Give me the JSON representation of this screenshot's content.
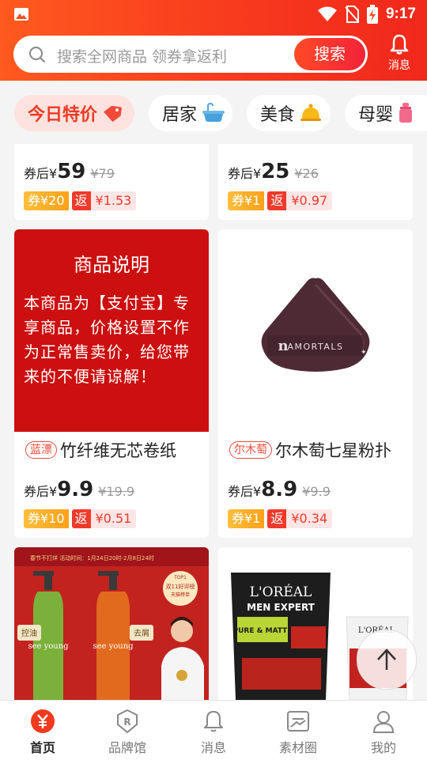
{
  "status": {
    "time": "9:17"
  },
  "header": {
    "search_placeholder": "搜索全网商品 领券拿返利",
    "search_button": "搜索",
    "message_label": "消息"
  },
  "categories": [
    {
      "label": "今日特价",
      "icon": "price-tag-icon",
      "active": true
    },
    {
      "label": "居家",
      "icon": "bathtub-icon",
      "active": false
    },
    {
      "label": "美食",
      "icon": "food-bell-icon",
      "active": false
    },
    {
      "label": "母婴",
      "icon": "baby-bottle-icon",
      "active": false
    }
  ],
  "products": [
    {
      "price_prefix": "券后¥",
      "price": "59",
      "original": "¥79",
      "coupon": "券¥20",
      "rebate_mark": "返",
      "rebate": "¥1.53"
    },
    {
      "price_prefix": "券后¥",
      "price": "25",
      "original": "¥26",
      "coupon": "券¥1",
      "rebate_mark": "返",
      "rebate": "¥0.97"
    },
    {
      "notice_title": "商品说明",
      "notice_text": "本商品为【支付宝】专享商品，价格设置不作为正常售卖价，给您带来的不便请谅解！",
      "shop": "蓝漂",
      "title": "竹纤维无芯卷纸",
      "price_prefix": "券后¥",
      "price": "9.9",
      "original": "¥19.9",
      "coupon": "券¥10",
      "rebate_mark": "返",
      "rebate": "¥0.51"
    },
    {
      "image_text": "AMORTALS",
      "shop": "尔木萄",
      "title": "尔木萄七星粉扑",
      "price_prefix": "券后¥",
      "price": "8.9",
      "original": "¥9.9",
      "coupon": "券¥1",
      "rebate_mark": "返",
      "rebate": "¥0.34"
    },
    {
      "banner_text": "春节不打烊 活动时间：1月24日20时-2月8日24时",
      "bottle_left": "控油",
      "bottle_right": "去屑",
      "brand": "see young",
      "badge_top": "TOP1",
      "badge_main": "双11好评榜",
      "badge_sub": "天猫榜单"
    },
    {
      "brand": "L'ORÉAL",
      "line": "MEN EXPERT",
      "sub": "PURE & MATTE"
    }
  ],
  "nav": [
    {
      "label": "首页",
      "active": true
    },
    {
      "label": "品牌馆",
      "active": false
    },
    {
      "label": "消息",
      "active": false
    },
    {
      "label": "素材圈",
      "active": false
    },
    {
      "label": "我的",
      "active": false
    }
  ],
  "colors": {
    "accent": "#f83a1e",
    "coupon": "#ffa118",
    "rebate": "#f03a2b"
  }
}
